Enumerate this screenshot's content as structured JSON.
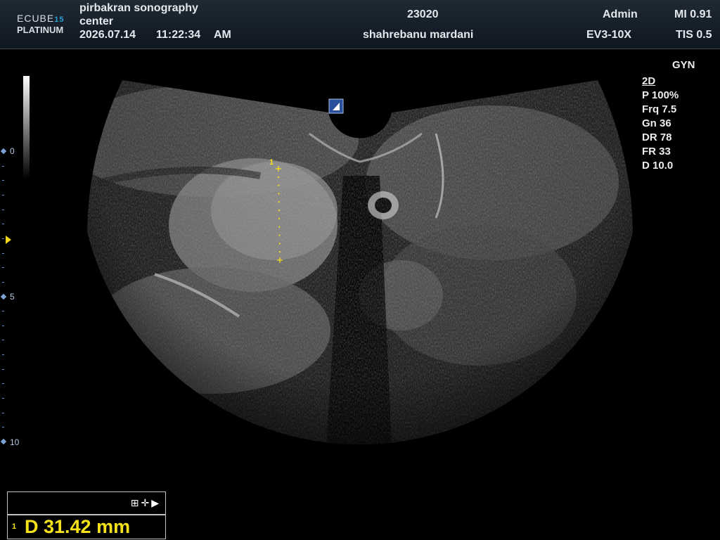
{
  "header": {
    "logo_line1": "ECUBE",
    "logo_line1_sup": "15",
    "logo_line2": "PLATINUM",
    "institution_line1": "pirbakran sonography",
    "institution_line2": "center",
    "date": "2026.07.14",
    "time": "11:22:34",
    "ampm": "AM",
    "patient_id": "23020",
    "patient_name": "shahrebanu mardani",
    "operator": "Admin",
    "probe": "EV3-10X",
    "mi": "MI 0.91",
    "tis": "TIS 0.5"
  },
  "params": {
    "preset": "GYN",
    "mode": "2D",
    "power": "P 100%",
    "frequency": "Frq 7.5",
    "gain": "Gn 36",
    "dynamic_range": "DR 78",
    "frame_rate": "FR 33",
    "depth": "D 10.0"
  },
  "depth_scale": {
    "labels": [
      "0",
      "5",
      "10"
    ]
  },
  "image": {
    "caliper_index": "1",
    "probe_orientation_icon": "probe-orientation-icon"
  },
  "measurement": {
    "tools_icons": [
      "grid-icon",
      "move-icon",
      "play-icon"
    ],
    "index": "1",
    "value_text": "D  31.42 mm"
  },
  "colors": {
    "caliper": "#f5e11a",
    "scale": "#7fa2d6",
    "header_bg": "#1a2530"
  }
}
